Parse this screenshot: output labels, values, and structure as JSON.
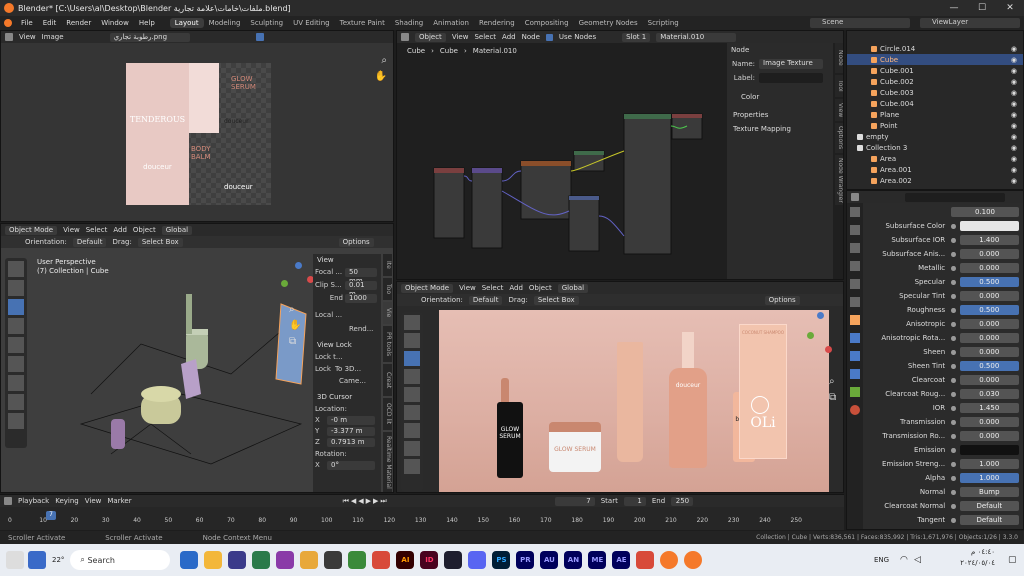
{
  "window": {
    "title": "Blender* [C:\\Users\\al\\Desktop\\Blender ملفات\\خامات\\علامة تجارية.blend]",
    "min": "—",
    "max": "☐",
    "close": "✕"
  },
  "menu": {
    "items": [
      "File",
      "Edit",
      "Render",
      "Window",
      "Help"
    ],
    "workspaces": [
      "Layout",
      "Modeling",
      "Sculpting",
      "UV Editing",
      "Texture Paint",
      "Shading",
      "Animation",
      "Rendering",
      "Compositing",
      "Geometry Nodes",
      "Scripting"
    ],
    "scene": "Scene",
    "view_layer": "ViewLayer"
  },
  "image_editor": {
    "view": "View",
    "image": "Image",
    "file": "رطوبة تجاري.png",
    "label1": "TENDEROUS",
    "label2": "douceur",
    "label3": "GLOW SERUM",
    "label4": "douceur",
    "label5": "BODY BALM",
    "label6": "douceur"
  },
  "node_editor": {
    "object": "Object",
    "view": "View",
    "select": "Select",
    "add": "Add",
    "node": "Node",
    "use_nodes": "Use Nodes",
    "slot": "Slot 1",
    "material": "Material.010",
    "bc1": "Cube",
    "bc2": "Cube",
    "bc3": "Material.010"
  },
  "node_panel": {
    "section": "Node",
    "name_label": "Name:",
    "name_value": "Image Texture",
    "label_label": "Label:",
    "color": "Color",
    "properties": "Properties",
    "texture_mapping": "Texture Mapping",
    "tabs": [
      "Node",
      "Tool",
      "View",
      "Options",
      "Node Wrangler"
    ]
  },
  "viewport_left": {
    "mode": "Object Mode",
    "view": "View",
    "select": "Select",
    "add": "Add",
    "object": "Object",
    "orient": "Global",
    "orientation_label": "Orientation:",
    "orientation": "Default",
    "drag_label": "Drag:",
    "drag": "Select Box",
    "options": "Options",
    "persp": "User Perspective",
    "coll": "(7) Collection | Cube"
  },
  "npanel": {
    "view": "View",
    "focal": "Focal ...",
    "focal_v": "50 mm",
    "clip_s": "Clip S...",
    "clip_s_v": "0.01 m",
    "end": "End",
    "end_v": "1000",
    "local": "Local ...",
    "rend": "Rend...",
    "view_lock": "View Lock",
    "lock_t": "Lock t...",
    "lock": "Lock",
    "to3d": "To 3D...",
    "came": "Came...",
    "cursor": "3D Cursor",
    "location": "Location:",
    "x": "X",
    "x_v": "-0 m",
    "y": "Y",
    "y_v": "-3.377 m",
    "z": "Z",
    "z_v": "0.7913 m",
    "rotation": "Rotation:",
    "rx": "X",
    "rx_v": "0°",
    "tabs": [
      "Ite",
      "Too",
      "Vie",
      "PR tools",
      "Creat",
      "OCD lit",
      "Realtime Material"
    ]
  },
  "viewport_right": {
    "mode": "Object Mode",
    "view": "View",
    "select": "Select",
    "add": "Add",
    "object": "Object",
    "orient": "Global",
    "orientation_label": "Orientation:",
    "orientation": "Default",
    "drag_label": "Drag:",
    "drag": "Select Box",
    "options": "Options",
    "p1": "GLOW SERUM",
    "p2": "GLOW SERUM",
    "p3": "beard oil",
    "p4": "douceur",
    "p5": "OLi",
    "p6": "COCONUT SHAMPOO"
  },
  "timeline": {
    "playback": "Playback",
    "keying": "Keying",
    "view": "View",
    "marker": "Marker",
    "frame": "7",
    "start_label": "Start",
    "start": "1",
    "end_label": "End",
    "end": "250",
    "ticks": [
      "0",
      "10",
      "20",
      "30",
      "40",
      "50",
      "60",
      "70",
      "80",
      "90",
      "100",
      "110",
      "120",
      "130",
      "140",
      "150",
      "160",
      "170",
      "180",
      "190",
      "200",
      "210",
      "220",
      "230",
      "240",
      "250"
    ],
    "current": "7"
  },
  "status": {
    "left1": "Scroller Activate",
    "left2": "Scroller Activate",
    "left3": "Node Context Menu",
    "right": "Collection | Cube | Verts:836,561 | Faces:835,992 | Tris:1,671,976 | Objects:1/26 | 3.3.0"
  },
  "outliner": {
    "items": [
      {
        "name": "Circle.014",
        "indent": 1,
        "sel": false
      },
      {
        "name": "Cube",
        "indent": 1,
        "sel": true
      },
      {
        "name": "Cube.001",
        "indent": 1,
        "sel": false
      },
      {
        "name": "Cube.002",
        "indent": 1,
        "sel": false
      },
      {
        "name": "Cube.003",
        "indent": 1,
        "sel": false
      },
      {
        "name": "Cube.004",
        "indent": 1,
        "sel": false
      },
      {
        "name": "Plane",
        "indent": 1,
        "sel": false
      },
      {
        "name": "Point",
        "indent": 1,
        "sel": false
      },
      {
        "name": "empty",
        "indent": 0,
        "sel": false
      },
      {
        "name": "Collection 3",
        "indent": 0,
        "sel": false
      },
      {
        "name": "Area",
        "indent": 1,
        "sel": false
      },
      {
        "name": "Area.001",
        "indent": 1,
        "sel": false
      },
      {
        "name": "Area.002",
        "indent": 1,
        "sel": false
      }
    ]
  },
  "properties": {
    "top_value": "0.100",
    "rows": [
      {
        "label": "Subsurface Color",
        "value": "",
        "style": "white"
      },
      {
        "label": "Subsurface IOR",
        "value": "1.400",
        "style": "normal"
      },
      {
        "label": "Subsurface Anis...",
        "value": "0.000",
        "style": "normal"
      },
      {
        "label": "Metallic",
        "value": "0.000",
        "style": "normal"
      },
      {
        "label": "Specular",
        "value": "0.500",
        "style": "blue"
      },
      {
        "label": "Specular Tint",
        "value": "0.000",
        "style": "normal"
      },
      {
        "label": "Roughness",
        "value": "0.500",
        "style": "blue"
      },
      {
        "label": "Anisotropic",
        "value": "0.000",
        "style": "normal"
      },
      {
        "label": "Anisotropic Rota...",
        "value": "0.000",
        "style": "normal"
      },
      {
        "label": "Sheen",
        "value": "0.000",
        "style": "normal"
      },
      {
        "label": "Sheen Tint",
        "value": "0.500",
        "style": "blue"
      },
      {
        "label": "Clearcoat",
        "value": "0.000",
        "style": "normal"
      },
      {
        "label": "Clearcoat Roug...",
        "value": "0.030",
        "style": "normal"
      },
      {
        "label": "IOR",
        "value": "1.450",
        "style": "normal"
      },
      {
        "label": "Transmission",
        "value": "0.000",
        "style": "normal"
      },
      {
        "label": "Transmission Ro...",
        "value": "0.000",
        "style": "normal"
      },
      {
        "label": "Emission",
        "value": "",
        "style": "black"
      },
      {
        "label": "Emission Streng...",
        "value": "1.000",
        "style": "normal"
      },
      {
        "label": "Alpha",
        "value": "1.000",
        "style": "blue"
      },
      {
        "label": "Normal",
        "value": "Bump",
        "style": "link"
      },
      {
        "label": "Clearcoat Normal",
        "value": "Default",
        "style": "link"
      },
      {
        "label": "Tangent",
        "value": "Default",
        "style": "link"
      }
    ]
  },
  "taskbar": {
    "weather": "22°",
    "search": "Search",
    "time": "٠٤:٤٠ م",
    "date": "٢٠٢٤/٠٥/٠٤",
    "lang": "ENG",
    "apps": [
      "AI",
      "ID",
      "PS",
      "PR",
      "AU",
      "AN",
      "ME",
      "AE"
    ]
  },
  "colors": {
    "accent": "#4772b3",
    "selected_orange": "#f5a35c",
    "blender_orange": "#f5792a"
  }
}
